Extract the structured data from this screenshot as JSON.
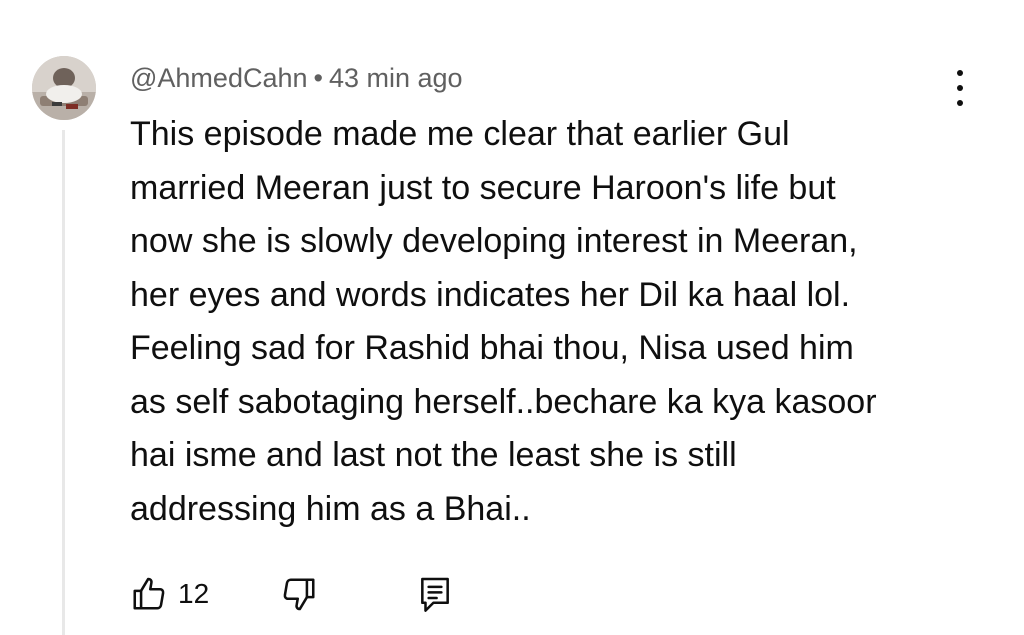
{
  "comment": {
    "author": "@AhmedCahn",
    "separator": "•",
    "time": "43 min ago",
    "lines": [
      "This episode made me clear that earlier Gul",
      "married Meeran just to secure Haroon's life but",
      "now she is slowly developing interest in Meeran,",
      "her eyes and words indicates her Dil ka haal lol.",
      "Feeling sad for Rashid bhai thou, Nisa used him",
      "as self sabotaging herself..bechare ka kya kasoor",
      "hai isme and last not the least she is still",
      "addressing him as a Bhai.."
    ],
    "like_count": "12",
    "icons": {
      "menu": "more-vert-icon",
      "like": "thumbs-up-icon",
      "dislike": "thumbs-down-icon",
      "reply": "reply-comment-icon"
    }
  }
}
